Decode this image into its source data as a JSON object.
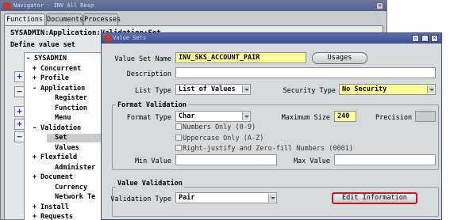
{
  "navigator": {
    "title": "Navigator - INV All Resp",
    "tabs": [
      "Functions",
      "Documents",
      "Processes"
    ],
    "heading": "SYSADMIN:Application:Validation:Set",
    "subheading": "Define value set",
    "tree": [
      {
        "sign": "-",
        "label": "SYSADMIN"
      },
      {
        "sign": "+",
        "label": "Concurrent"
      },
      {
        "sign": "+",
        "label": "Profile"
      },
      {
        "sign": "-",
        "label": "Application"
      },
      {
        "sign": "",
        "label": "Register"
      },
      {
        "sign": "",
        "label": "Function"
      },
      {
        "sign": "",
        "label": "Menu"
      },
      {
        "sign": "-",
        "label": "Validation"
      },
      {
        "sign": "",
        "label": "Set"
      },
      {
        "sign": "",
        "label": "Values"
      },
      {
        "sign": "+",
        "label": "Flexfield"
      },
      {
        "sign": "",
        "label": "Administer"
      },
      {
        "sign": "+",
        "label": "Document"
      },
      {
        "sign": "",
        "label": "Currency"
      },
      {
        "sign": "",
        "label": "Network Te"
      },
      {
        "sign": "+",
        "label": "Install"
      },
      {
        "sign": "+",
        "label": "Requests"
      }
    ],
    "side_buttons": [
      "+",
      "−",
      "+",
      "+",
      "−"
    ]
  },
  "value_sets": {
    "title": "Value Sets",
    "value_set_name_label": "Value Set Name",
    "value_set_name": "INV_SKS_ACCOUNT_PAIR",
    "usages_button": "Usages",
    "description_label": "Description",
    "description": "",
    "list_type_label": "List Type",
    "list_type": "List of Values",
    "security_type_label": "Security Type",
    "security_type": "No Security",
    "format_validation": {
      "title": "Format Validation",
      "format_type_label": "Format Type",
      "format_type": "Char",
      "maximum_size_label": "Maximum Size",
      "maximum_size": "240",
      "precision_label": "Precision",
      "precision": "",
      "numbers_only": "Numbers Only (0-9)",
      "uppercase_only": "Uppercase Only (A-Z)",
      "right_justify": "Right-justify and Zero-fill Numbers (0001)",
      "min_value_label": "Min Value",
      "min_value": "",
      "max_value_label": "Max Value",
      "max_value": ""
    },
    "value_validation": {
      "title": "Value Validation",
      "validation_type_label": "Validation Type",
      "validation_type": "Pair",
      "edit_information_button": "Edit Information"
    }
  }
}
